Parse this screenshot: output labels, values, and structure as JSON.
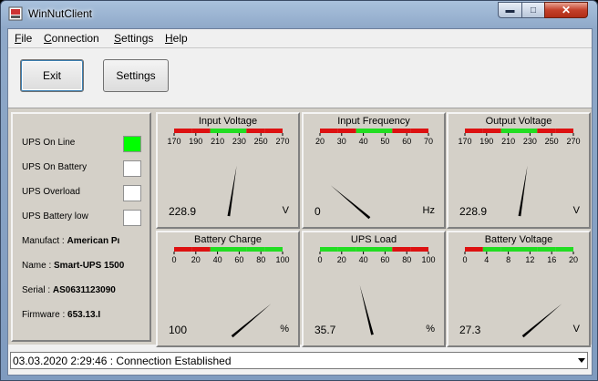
{
  "window": {
    "title": "WinNutClient"
  },
  "menu": [
    {
      "label": "File",
      "underline": "F",
      "rest": "ile"
    },
    {
      "label": "Connection",
      "underline": "C",
      "rest": "onnection"
    },
    {
      "label": "Settings",
      "underline": "S",
      "rest": "ettings"
    },
    {
      "label": "Help",
      "underline": "H",
      "rest": "elp"
    }
  ],
  "toolbar": {
    "exit_label": "Exit",
    "settings_label": "Settings"
  },
  "status": {
    "indicators": [
      {
        "label": "UPS On Line",
        "active": true
      },
      {
        "label": "UPS On Battery",
        "active": false
      },
      {
        "label": "UPS Overload",
        "active": false
      },
      {
        "label": "UPS Battery low",
        "active": false
      }
    ],
    "manufacturer_label": "Manufact :",
    "manufacturer": "American Pı",
    "name_label": "Name :",
    "name": "Smart-UPS 1500",
    "serial_label": "Serial :",
    "serial": "AS0631123090",
    "firmware_label": "Firmware :",
    "firmware": "653.13.I"
  },
  "gauges": [
    {
      "id": "input-voltage",
      "title": "Input Voltage",
      "ticks": [
        "170",
        "190",
        "210",
        "230",
        "250",
        "270"
      ],
      "min": 170,
      "max": 270,
      "value": 228.9,
      "value_text": "228.9",
      "unit": "V",
      "bands": [
        "red",
        "red",
        "green",
        "green",
        "red",
        "red"
      ]
    },
    {
      "id": "input-frequency",
      "title": "Input Frequency",
      "ticks": [
        "20",
        "30",
        "40",
        "50",
        "60",
        "70"
      ],
      "min": 20,
      "max": 70,
      "value": 0,
      "value_text": "0",
      "unit": "Hz",
      "bands": [
        "red",
        "red",
        "green",
        "green",
        "red",
        "red"
      ]
    },
    {
      "id": "output-voltage",
      "title": "Output Voltage",
      "ticks": [
        "170",
        "190",
        "210",
        "230",
        "250",
        "270"
      ],
      "min": 170,
      "max": 270,
      "value": 228.9,
      "value_text": "228.9",
      "unit": "V",
      "bands": [
        "red",
        "red",
        "green",
        "green",
        "red",
        "red"
      ]
    },
    {
      "id": "battery-charge",
      "title": "Battery Charge",
      "ticks": [
        "0",
        "20",
        "40",
        "60",
        "80",
        "100"
      ],
      "min": 0,
      "max": 100,
      "value": 100,
      "value_text": "100",
      "unit": "%",
      "bands": [
        "red",
        "red",
        "green",
        "green",
        "green",
        "green"
      ]
    },
    {
      "id": "ups-load",
      "title": "UPS Load",
      "ticks": [
        "0",
        "20",
        "40",
        "60",
        "80",
        "100"
      ],
      "min": 0,
      "max": 100,
      "value": 35.7,
      "value_text": "35.7",
      "unit": "%",
      "bands": [
        "green",
        "green",
        "green",
        "green",
        "red",
        "red"
      ]
    },
    {
      "id": "battery-voltage",
      "title": "Battery Voltage",
      "ticks": [
        "0",
        "4",
        "8",
        "12",
        "16",
        "20"
      ],
      "min": 0,
      "max": 20,
      "value": 27.3,
      "value_text": "27.3",
      "unit": "V",
      "bands": [
        "red",
        "green",
        "green",
        "green",
        "green",
        "green"
      ]
    }
  ],
  "statusbar": {
    "text": "03.03.2020 2:29:46 : Connection Established"
  },
  "colors": {
    "active_indicator": "#00ff00",
    "band_green": "#22dd22",
    "band_red": "#dd1111"
  }
}
